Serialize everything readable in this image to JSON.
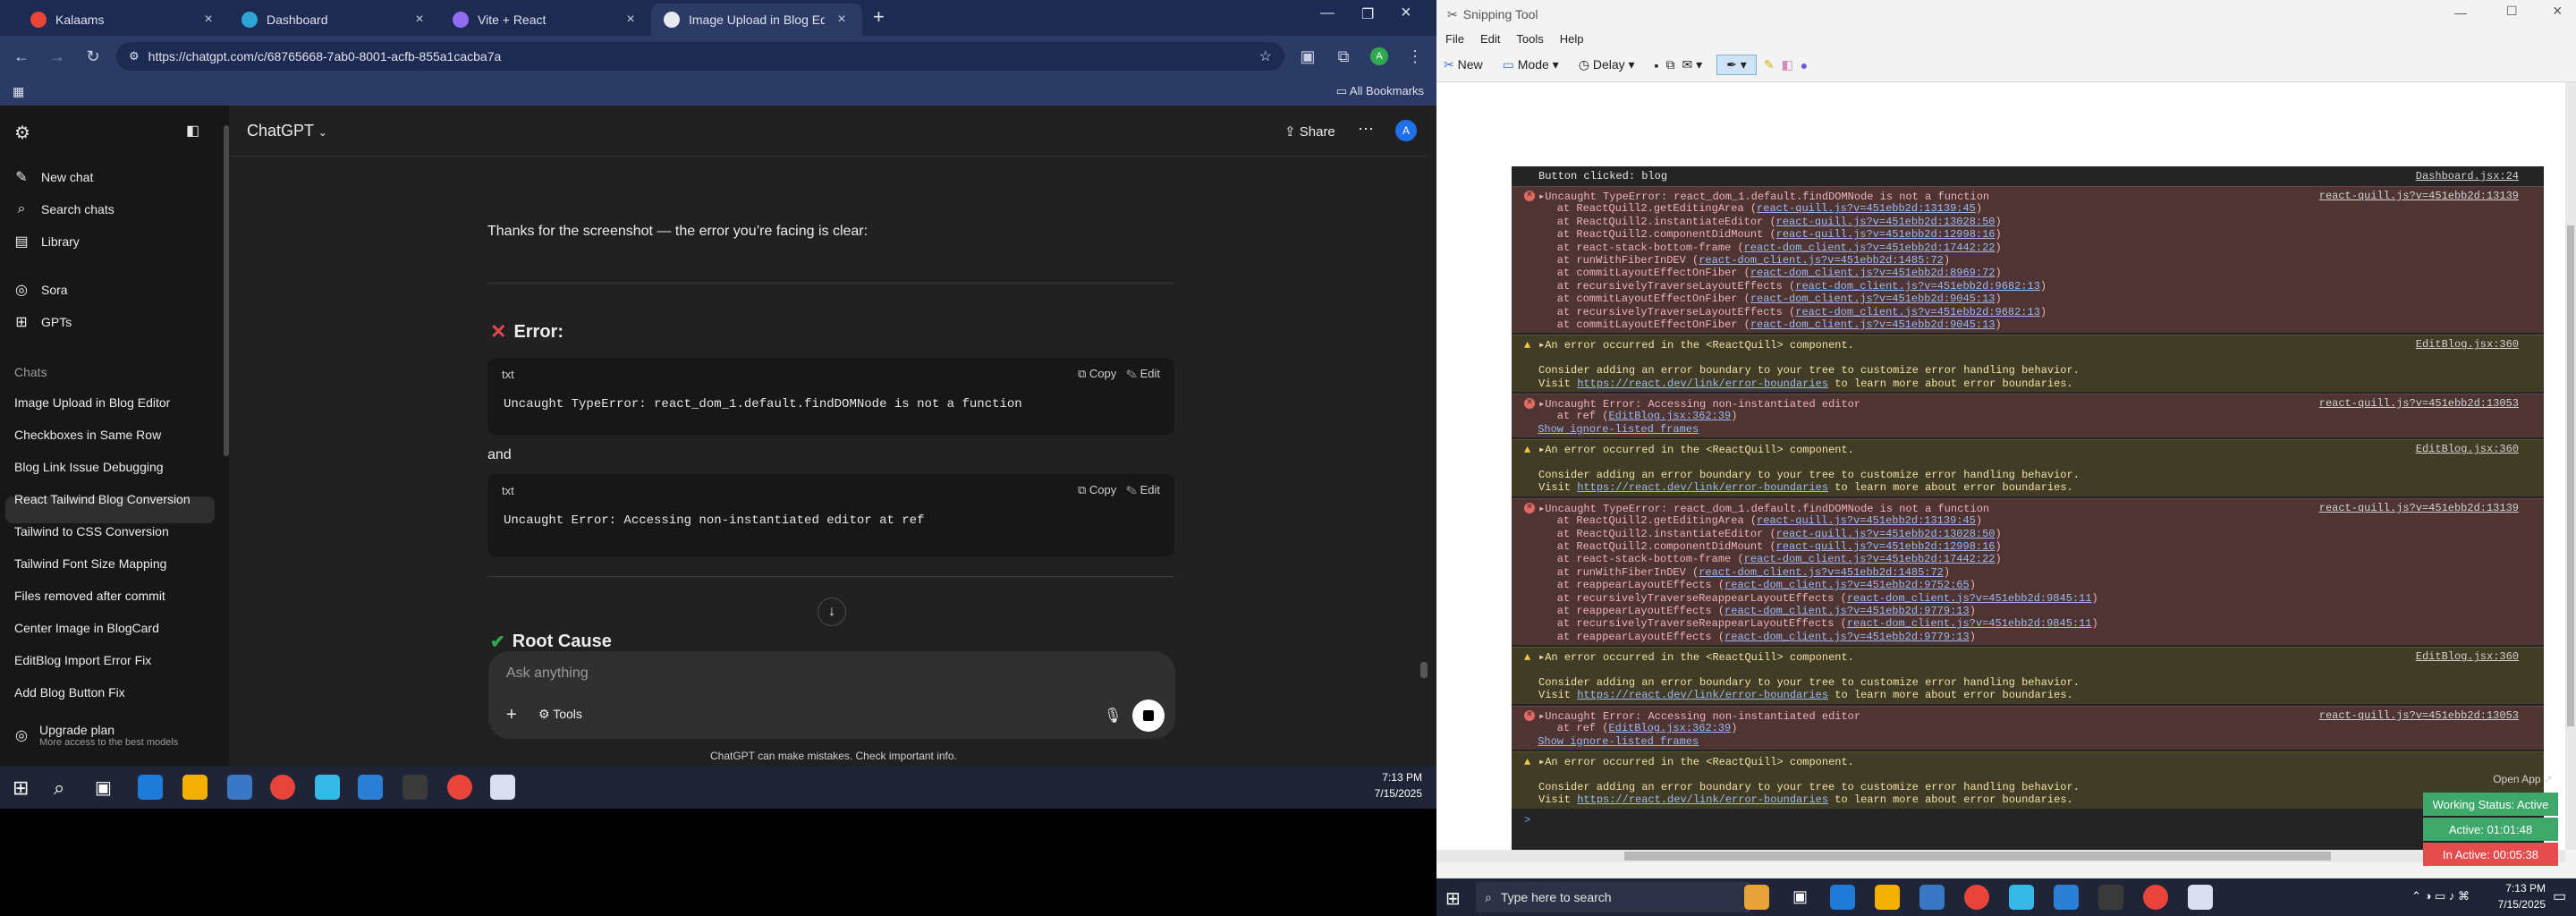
{
  "tabs": [
    {
      "label": "Kalaams",
      "color": "#e8443a",
      "active": false
    },
    {
      "label": "Dashboard",
      "color": "#2ea3d6",
      "active": false
    },
    {
      "label": "Vite + React",
      "color": "#8f6cf0",
      "active": false
    },
    {
      "label": "Image Upload in Blog Editor",
      "color": "#e8eaf0",
      "active": true
    }
  ],
  "address": {
    "url": "https://chatgpt.com/c/68765668-7ab0-8001-acfb-855a1cacba7a",
    "profile_initial": "A"
  },
  "bookmarks": {
    "all_label": "All Bookmarks"
  },
  "sidebar": {
    "top_items": [
      {
        "label": "New chat",
        "icon": "edit-icon"
      },
      {
        "label": "Search chats",
        "icon": "search-icon"
      },
      {
        "label": "Library",
        "icon": "library-icon"
      }
    ],
    "apps": [
      {
        "label": "Sora",
        "icon": "sora-icon"
      },
      {
        "label": "GPTs",
        "icon": "grid-icon"
      }
    ],
    "chats_heading": "Chats",
    "chats": [
      "Image Upload in Blog Editor",
      "Checkboxes in Same Row",
      "Blog Link Issue Debugging",
      "React Tailwind Blog Conversion",
      "Tailwind to CSS Conversion",
      "Tailwind Font Size Mapping",
      "Files removed after commit",
      "Center Image in BlogCard",
      "EditBlog Import Error Fix",
      "Add Blog Button Fix"
    ],
    "upgrade_title": "Upgrade plan",
    "upgrade_sub": "More access to the best models"
  },
  "main": {
    "model": "ChatGPT",
    "share": "Share",
    "avatar": "A",
    "intro": "Thanks for the screenshot — the error you’re facing is clear:",
    "error_heading": "Error:",
    "code1": {
      "lang": "txt",
      "copy": "Copy",
      "edit": "Edit",
      "code": "Uncaught TypeError: react_dom_1.default.findDOMNode is not a function"
    },
    "and": "and",
    "code2": {
      "lang": "txt",
      "copy": "Copy",
      "edit": "Edit",
      "code": "Uncaught Error: Accessing non-instantiated editor at ref"
    },
    "root_heading": "Root Cause",
    "composer_placeholder": "Ask anything",
    "tools": "Tools",
    "disclaimer": "ChatGPT can make mistakes. Check important info."
  },
  "taskbar_left": {
    "time": "7:13 PM",
    "date": "7/15/2025"
  },
  "snip": {
    "title": "Snipping Tool",
    "menu": [
      "File",
      "Edit",
      "Tools",
      "Help"
    ],
    "new": "New",
    "mode": "Mode",
    "delay": "Delay"
  },
  "console": {
    "top_line": "Button clicked: blog",
    "top_link": "Dashboard.jsx:24",
    "blocks": [
      {
        "type": "error",
        "lines": [
          "▸Uncaught TypeError: react_dom_1.default.findDOMNode is not a function",
          "    at ReactQuill2.getEditingArea (react-quill.js?v=451ebb2d:13139:45)",
          "    at ReactQuill2.instantiateEditor (react-quill.js?v=451ebb2d:13028:50)",
          "    at ReactQuill2.componentDidMount (react-quill.js?v=451ebb2d:12998:16)",
          "    at react-stack-bottom-frame (react-dom_client.js?v=451ebb2d:17442:22)",
          "    at runWithFiberInDEV (react-dom_client.js?v=451ebb2d:1485:72)",
          "    at commitLayoutEffectOnFiber (react-dom_client.js?v=451ebb2d:8969:72)",
          "    at recursivelyTraverseLayoutEffects (react-dom_client.js?v=451ebb2d:9682:13)",
          "    at commitLayoutEffectOnFiber (react-dom_client.js?v=451ebb2d:9045:13)",
          "    at recursivelyTraverseLayoutEffects (react-dom_client.js?v=451ebb2d:9682:13)",
          "    at commitLayoutEffectOnFiber (react-dom_client.js?v=451ebb2d:9045:13)"
        ],
        "link": "react-quill.js?v=451ebb2d:13139"
      },
      {
        "type": "warn",
        "lines": [
          "▸An error occurred in the <ReactQuill> component.",
          "",
          "Consider adding an error boundary to your tree to customize error handling behavior.",
          "Visit https://react.dev/link/error-boundaries to learn more about error boundaries."
        ],
        "link": "EditBlog.jsx:360"
      },
      {
        "type": "error",
        "lines": [
          "▸Uncaught Error: Accessing non-instantiated editor",
          "    at ref (EditBlog.jsx:362:39)",
          " Show ignore-listed frames"
        ],
        "link": "react-quill.js?v=451ebb2d:13053"
      },
      {
        "type": "warn",
        "lines": [
          "▸An error occurred in the <ReactQuill> component.",
          "",
          "Consider adding an error boundary to your tree to customize error handling behavior.",
          "Visit https://react.dev/link/error-boundaries to learn more about error boundaries."
        ],
        "link": "EditBlog.jsx:360"
      },
      {
        "type": "error",
        "lines": [
          "▸Uncaught TypeError: react_dom_1.default.findDOMNode is not a function",
          "    at ReactQuill2.getEditingArea (react-quill.js?v=451ebb2d:13139:45)",
          "    at ReactQuill2.instantiateEditor (react-quill.js?v=451ebb2d:13028:50)",
          "    at ReactQuill2.componentDidMount (react-quill.js?v=451ebb2d:12998:16)",
          "    at react-stack-bottom-frame (react-dom_client.js?v=451ebb2d:17442:22)",
          "    at runWithFiberInDEV (react-dom_client.js?v=451ebb2d:1485:72)",
          "    at reappearLayoutEffects (react-dom_client.js?v=451ebb2d:9752:65)",
          "    at recursivelyTraverseReappearLayoutEffects (react-dom_client.js?v=451ebb2d:9845:11)",
          "    at reappearLayoutEffects (react-dom_client.js?v=451ebb2d:9779:13)",
          "    at recursivelyTraverseReappearLayoutEffects (react-dom_client.js?v=451ebb2d:9845:11)",
          "    at reappearLayoutEffects (react-dom_client.js?v=451ebb2d:9779:13)"
        ],
        "link": "react-quill.js?v=451ebb2d:13139"
      },
      {
        "type": "warn",
        "lines": [
          "▸An error occurred in the <ReactQuill> component.",
          "",
          "Consider adding an error boundary to your tree to customize error handling behavior.",
          "Visit https://react.dev/link/error-boundaries to learn more about error boundaries."
        ],
        "link": "EditBlog.jsx:360"
      },
      {
        "type": "error",
        "lines": [
          "▸Uncaught Error: Accessing non-instantiated editor",
          "    at ref (EditBlog.jsx:362:39)",
          " Show ignore-listed frames"
        ],
        "link": "react-quill.js?v=451ebb2d:13053"
      },
      {
        "type": "warn",
        "lines": [
          "▸An error occurred in the <ReactQuill> component.",
          "",
          "Consider adding an error boundary to your tree to customize error handling behavior.",
          "Visit https://react.dev/link/error-boundaries to learn more about error boundaries."
        ],
        "link": ""
      }
    ],
    "prompt": ">"
  },
  "status": {
    "open_app": "Open App ↗",
    "working": "Working Status: Active",
    "active": "Active: 01:01:48",
    "inactive": "In Active: 00:05:38"
  },
  "taskbar_right": {
    "search_placeholder": "Type here to search",
    "time": "7:13 PM",
    "date": "7/15/2025"
  }
}
